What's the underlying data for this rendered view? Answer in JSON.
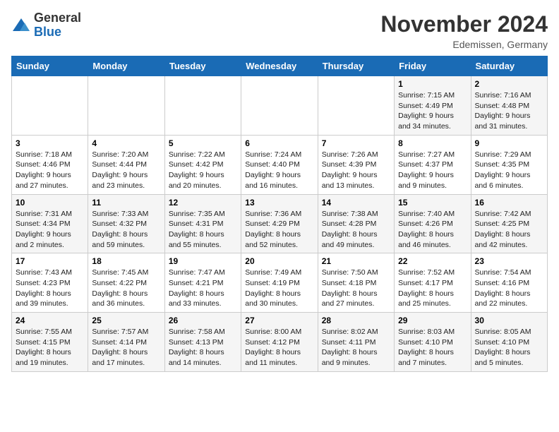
{
  "header": {
    "logo_line1": "General",
    "logo_line2": "Blue",
    "month": "November 2024",
    "location": "Edemissen, Germany"
  },
  "days_of_week": [
    "Sunday",
    "Monday",
    "Tuesday",
    "Wednesday",
    "Thursday",
    "Friday",
    "Saturday"
  ],
  "weeks": [
    [
      {
        "day": "",
        "info": ""
      },
      {
        "day": "",
        "info": ""
      },
      {
        "day": "",
        "info": ""
      },
      {
        "day": "",
        "info": ""
      },
      {
        "day": "",
        "info": ""
      },
      {
        "day": "1",
        "info": "Sunrise: 7:15 AM\nSunset: 4:49 PM\nDaylight: 9 hours and 34 minutes."
      },
      {
        "day": "2",
        "info": "Sunrise: 7:16 AM\nSunset: 4:48 PM\nDaylight: 9 hours and 31 minutes."
      }
    ],
    [
      {
        "day": "3",
        "info": "Sunrise: 7:18 AM\nSunset: 4:46 PM\nDaylight: 9 hours and 27 minutes."
      },
      {
        "day": "4",
        "info": "Sunrise: 7:20 AM\nSunset: 4:44 PM\nDaylight: 9 hours and 23 minutes."
      },
      {
        "day": "5",
        "info": "Sunrise: 7:22 AM\nSunset: 4:42 PM\nDaylight: 9 hours and 20 minutes."
      },
      {
        "day": "6",
        "info": "Sunrise: 7:24 AM\nSunset: 4:40 PM\nDaylight: 9 hours and 16 minutes."
      },
      {
        "day": "7",
        "info": "Sunrise: 7:26 AM\nSunset: 4:39 PM\nDaylight: 9 hours and 13 minutes."
      },
      {
        "day": "8",
        "info": "Sunrise: 7:27 AM\nSunset: 4:37 PM\nDaylight: 9 hours and 9 minutes."
      },
      {
        "day": "9",
        "info": "Sunrise: 7:29 AM\nSunset: 4:35 PM\nDaylight: 9 hours and 6 minutes."
      }
    ],
    [
      {
        "day": "10",
        "info": "Sunrise: 7:31 AM\nSunset: 4:34 PM\nDaylight: 9 hours and 2 minutes."
      },
      {
        "day": "11",
        "info": "Sunrise: 7:33 AM\nSunset: 4:32 PM\nDaylight: 8 hours and 59 minutes."
      },
      {
        "day": "12",
        "info": "Sunrise: 7:35 AM\nSunset: 4:31 PM\nDaylight: 8 hours and 55 minutes."
      },
      {
        "day": "13",
        "info": "Sunrise: 7:36 AM\nSunset: 4:29 PM\nDaylight: 8 hours and 52 minutes."
      },
      {
        "day": "14",
        "info": "Sunrise: 7:38 AM\nSunset: 4:28 PM\nDaylight: 8 hours and 49 minutes."
      },
      {
        "day": "15",
        "info": "Sunrise: 7:40 AM\nSunset: 4:26 PM\nDaylight: 8 hours and 46 minutes."
      },
      {
        "day": "16",
        "info": "Sunrise: 7:42 AM\nSunset: 4:25 PM\nDaylight: 8 hours and 42 minutes."
      }
    ],
    [
      {
        "day": "17",
        "info": "Sunrise: 7:43 AM\nSunset: 4:23 PM\nDaylight: 8 hours and 39 minutes."
      },
      {
        "day": "18",
        "info": "Sunrise: 7:45 AM\nSunset: 4:22 PM\nDaylight: 8 hours and 36 minutes."
      },
      {
        "day": "19",
        "info": "Sunrise: 7:47 AM\nSunset: 4:21 PM\nDaylight: 8 hours and 33 minutes."
      },
      {
        "day": "20",
        "info": "Sunrise: 7:49 AM\nSunset: 4:19 PM\nDaylight: 8 hours and 30 minutes."
      },
      {
        "day": "21",
        "info": "Sunrise: 7:50 AM\nSunset: 4:18 PM\nDaylight: 8 hours and 27 minutes."
      },
      {
        "day": "22",
        "info": "Sunrise: 7:52 AM\nSunset: 4:17 PM\nDaylight: 8 hours and 25 minutes."
      },
      {
        "day": "23",
        "info": "Sunrise: 7:54 AM\nSunset: 4:16 PM\nDaylight: 8 hours and 22 minutes."
      }
    ],
    [
      {
        "day": "24",
        "info": "Sunrise: 7:55 AM\nSunset: 4:15 PM\nDaylight: 8 hours and 19 minutes."
      },
      {
        "day": "25",
        "info": "Sunrise: 7:57 AM\nSunset: 4:14 PM\nDaylight: 8 hours and 17 minutes."
      },
      {
        "day": "26",
        "info": "Sunrise: 7:58 AM\nSunset: 4:13 PM\nDaylight: 8 hours and 14 minutes."
      },
      {
        "day": "27",
        "info": "Sunrise: 8:00 AM\nSunset: 4:12 PM\nDaylight: 8 hours and 11 minutes."
      },
      {
        "day": "28",
        "info": "Sunrise: 8:02 AM\nSunset: 4:11 PM\nDaylight: 8 hours and 9 minutes."
      },
      {
        "day": "29",
        "info": "Sunrise: 8:03 AM\nSunset: 4:10 PM\nDaylight: 8 hours and 7 minutes."
      },
      {
        "day": "30",
        "info": "Sunrise: 8:05 AM\nSunset: 4:10 PM\nDaylight: 8 hours and 5 minutes."
      }
    ]
  ]
}
